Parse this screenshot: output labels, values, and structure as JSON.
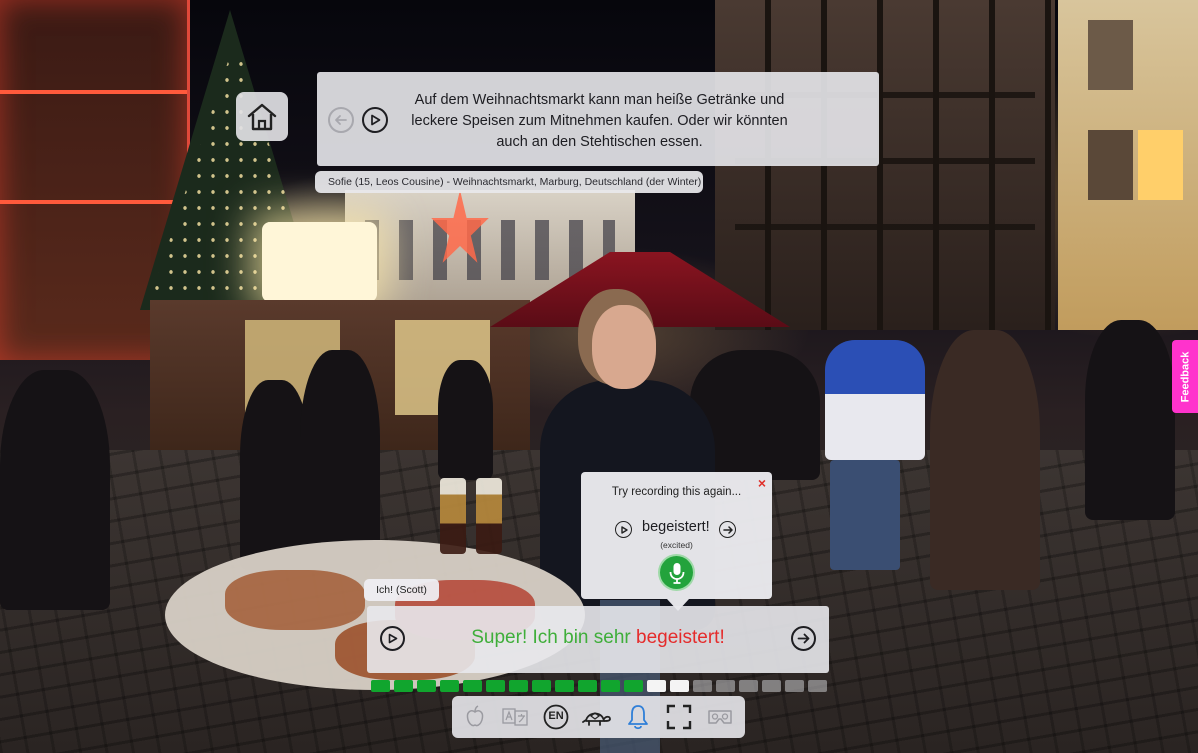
{
  "header": {
    "prev_label": "",
    "play_label": "",
    "description_lines": [
      "Auf dem Weihnachtsmarkt kann man heiße Getränke und",
      "leckere Speisen zum Mitnehmen kaufen. Oder wir könnten",
      "auch an den Stehtischen essen."
    ]
  },
  "speaker": {
    "caption": "Sofie (15, Leos Cousine) - Weihnachtsmarkt, Marburg, Deutschland (der Winter)"
  },
  "dialog": {
    "speaker_tag": "Ich! (Scott)",
    "answer_correct": "Super! Ich bin sehr",
    "answer_error": "begeistert!"
  },
  "record_popup": {
    "close": "×",
    "title": "Try recording this again...",
    "word": "begeistert!",
    "translation": "(excited)"
  },
  "progress": {
    "completed": 12,
    "current": 2,
    "total": 20,
    "colors": {
      "completed": "#11a52e",
      "current": "#f4f4f4",
      "remaining": "#c8c8cc"
    }
  },
  "toolbar": {
    "language_badge": "EN",
    "icons": [
      "apple-icon",
      "translate-icon",
      "language-icon",
      "turtle-icon",
      "bell-icon",
      "fullscreen-icon",
      "vr-headset-icon"
    ]
  },
  "feedback": {
    "label": "Feedback"
  },
  "colors": {
    "accent_green": "#23a33c",
    "error_red": "#e52b2b",
    "correct_green": "#3fae3a",
    "feedback_pink": "#ff33cc",
    "bell_blue": "#2f7fd8"
  }
}
